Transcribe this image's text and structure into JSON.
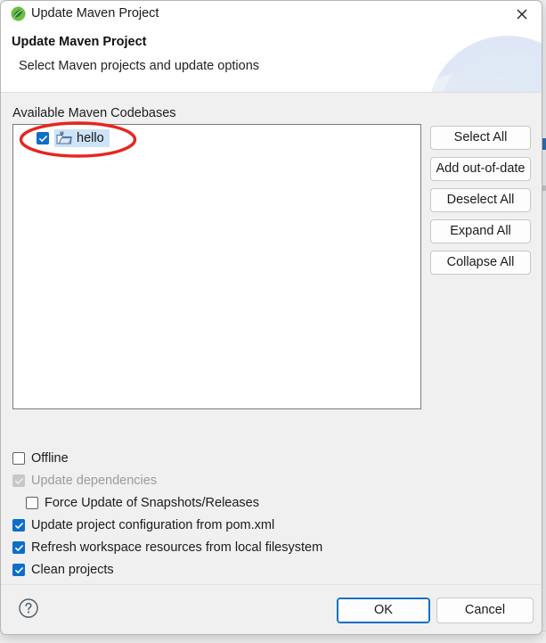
{
  "window": {
    "title": "Update Maven Project",
    "app_icon": "maven-leaf-icon",
    "close_icon": "close-icon"
  },
  "header": {
    "title": "Update Maven Project",
    "subtitle": "Select Maven projects and update options"
  },
  "main": {
    "section_label": "Available Maven Codebases",
    "tree": {
      "items": [
        {
          "label": "hello",
          "checked": true,
          "selected": true,
          "icon": "maven-project-folder-icon"
        }
      ]
    },
    "side_buttons": [
      {
        "label": "Select All"
      },
      {
        "label": "Add out-of-date"
      },
      {
        "label": "Deselect All"
      },
      {
        "label": "Expand All"
      },
      {
        "label": "Collapse All"
      }
    ],
    "options": [
      {
        "label": "Offline",
        "state": "unchecked",
        "disabled": false,
        "indent": 0
      },
      {
        "label": "Update dependencies",
        "state": "checked",
        "disabled": true,
        "indent": 0
      },
      {
        "label": "Force Update of Snapshots/Releases",
        "state": "unchecked",
        "disabled": false,
        "indent": 1
      },
      {
        "label": "Update project configuration from pom.xml",
        "state": "checked",
        "disabled": false,
        "indent": 0
      },
      {
        "label": "Refresh workspace resources from local filesystem",
        "state": "checked",
        "disabled": false,
        "indent": 0
      },
      {
        "label": "Clean projects",
        "state": "checked",
        "disabled": false,
        "indent": 0
      }
    ]
  },
  "footer": {
    "help_icon": "help-circle-icon",
    "ok_label": "OK",
    "cancel_label": "Cancel"
  },
  "annotation": {
    "shape": "ellipse",
    "color": "#e8251f",
    "target": "hello"
  },
  "colors": {
    "accent_checkbox": "#0d6ec9",
    "selection": "#cde3f7",
    "dialog_bg": "#f0f0f0",
    "header_bg": "#ffffff",
    "annotation_red": "#e8251f",
    "focus_blue": "#1570c0"
  }
}
